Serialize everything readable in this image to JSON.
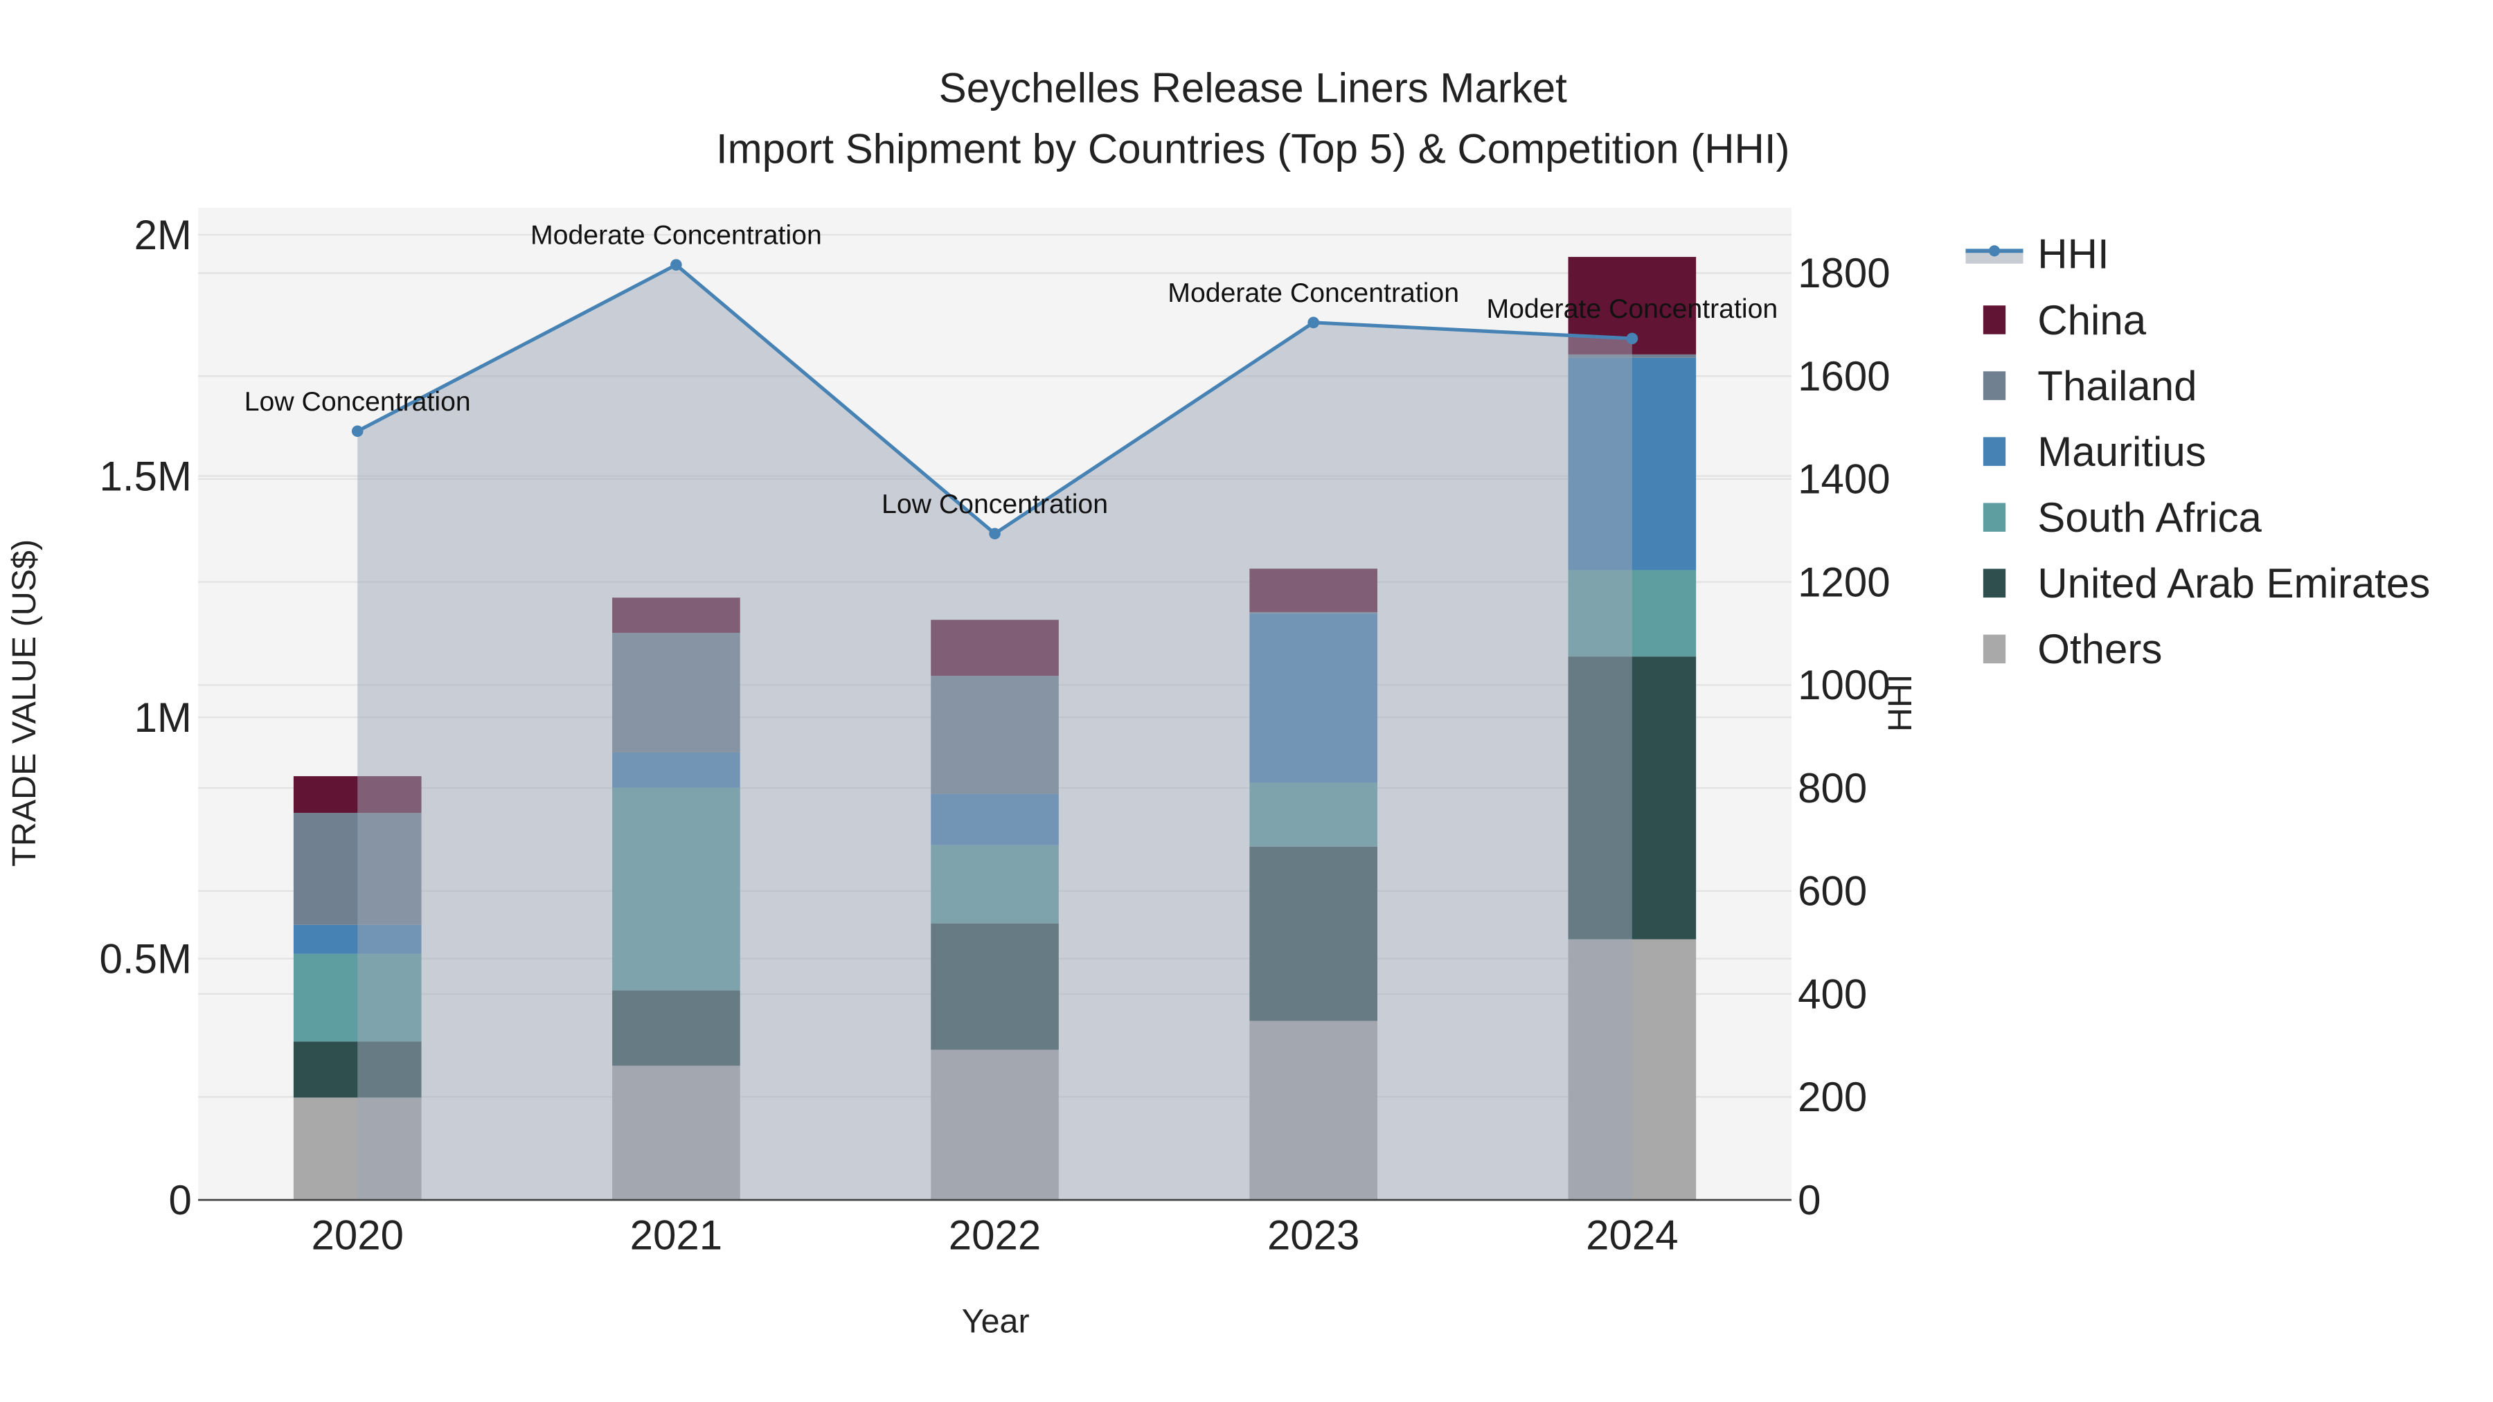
{
  "chart_data": {
    "type": "bar",
    "stacked": true,
    "title": "Seychelles Release Liners Market",
    "subtitle": "Import Shipment by Countries (Top 5) & Competition (HHI)",
    "xlabel": "Year",
    "ylabel": "TRADE VALUE (US$)",
    "y2label": "HHI",
    "categories": [
      "2020",
      "2021",
      "2022",
      "2023",
      "2024"
    ],
    "ylim": [
      0,
      2056000
    ],
    "y2lim": [
      0,
      1927
    ],
    "yticks": [
      {
        "v": 0,
        "label": "0"
      },
      {
        "v": 500000,
        "label": "0.5M"
      },
      {
        "v": 1000000,
        "label": "1M"
      },
      {
        "v": 1500000,
        "label": "1.5M"
      },
      {
        "v": 2000000,
        "label": "2M"
      }
    ],
    "y2ticks": [
      0,
      200,
      400,
      600,
      800,
      1000,
      1200,
      1400,
      1600,
      1800
    ],
    "grid": true,
    "legend_position": "right",
    "series": [
      {
        "name": "Others",
        "color": "#A9A9A9",
        "values": [
          212000,
          278000,
          311000,
          371000,
          540000
        ]
      },
      {
        "name": "United Arab Emirates",
        "color": "#2F4F4F",
        "values": [
          116000,
          156000,
          262000,
          361000,
          586000
        ]
      },
      {
        "name": "South Africa",
        "color": "#5F9EA0",
        "values": [
          182000,
          420000,
          162000,
          132000,
          179000
        ]
      },
      {
        "name": "Mauritius",
        "color": "#4682B4",
        "values": [
          60000,
          73000,
          106000,
          351000,
          440000
        ]
      },
      {
        "name": "Thailand",
        "color": "#708090",
        "values": [
          232000,
          248000,
          245000,
          3000,
          7000
        ]
      },
      {
        "name": "China",
        "color": "#611434",
        "values": [
          76000,
          73000,
          116000,
          90000,
          202000
        ]
      }
    ],
    "legend_order": [
      "HHI",
      "China",
      "Thailand",
      "Mauritius",
      "South Africa",
      "United Arab Emirates",
      "Others"
    ],
    "hhi": {
      "name": "HHI",
      "color": "#4682B4",
      "values": [
        1493,
        1816,
        1294,
        1704,
        1673
      ],
      "annotations": [
        "Low Concentration",
        "Moderate Concentration",
        "Low Concentration",
        "Moderate Concentration",
        "Moderate Concentration"
      ]
    }
  }
}
